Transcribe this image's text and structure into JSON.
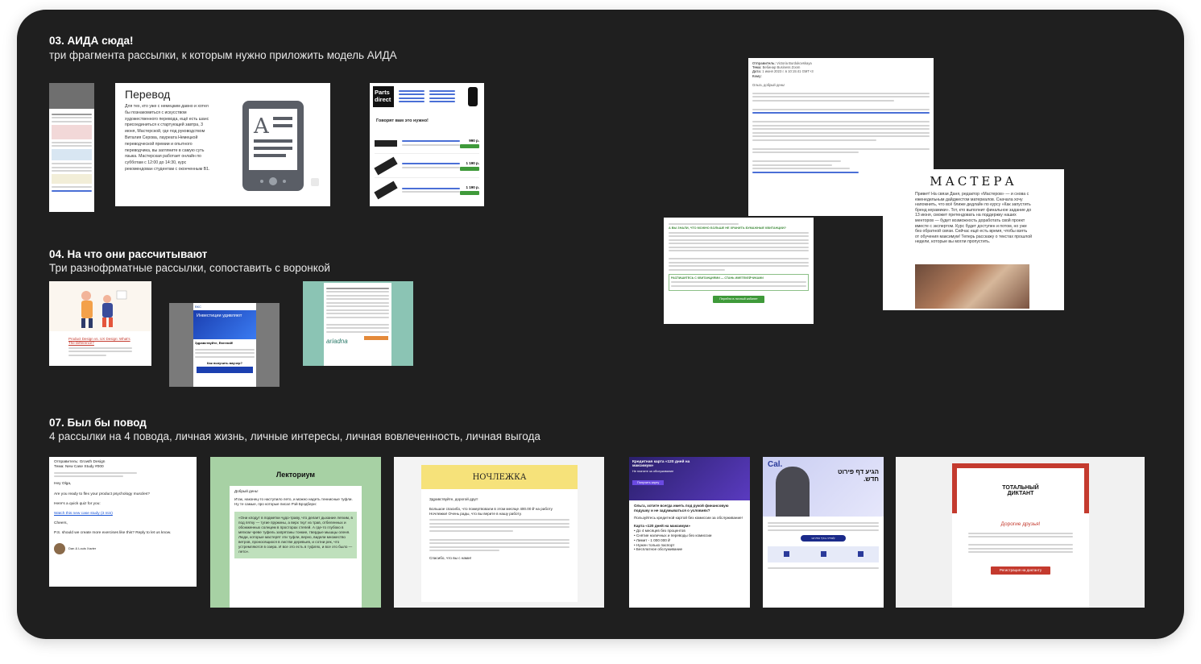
{
  "sections": {
    "s03": {
      "title": "03. АИДА сюда!",
      "subtitle": "три фрагмента рассылки, к которым нужно приложить модель АИДА"
    },
    "s04": {
      "title": "04. На что они рассчитывают",
      "subtitle": "Три разнофрматные рассылки, сопоставить с воронкой"
    },
    "s07": {
      "title": "07. Был бы повод",
      "subtitle": "4 рассылки на 4 повода, личная жизнь, личные интересы, личная вовлеченность, личная выгода"
    }
  },
  "cards": {
    "perevod": {
      "title": "Перевод",
      "body": "Для тех, кто уже с немецким давно и хотел бы познакомиться с искусством художественного перевода, ещё есть шанс присоединиться к стартующей завтра, 3 июня, Мастерской, где под руководством Виталия Серова, лауреата Немецкой переводческой премии и опытного переводчика, вы загляните в самую суть языка. Мастерская работает онлайн по субботам с 12:00 до 14:30, курс рекомендован студентам с оконченным B1."
    },
    "parts": {
      "logo_line1": "Parts",
      "logo_line2": "direct",
      "headline": "Говорят вам это нужно!",
      "prices": [
        "990 р.",
        "1 190 р.",
        "1 190 р."
      ]
    },
    "business_email": {
      "from_label": "Отправитель:",
      "from": "Victoria Burdukovskaya",
      "subject_label": "Тема:",
      "subject": "Вебинар Business Zoom",
      "date_label": "Дата:",
      "date": "1 июня 2023 г. в 10:15:41 GMT+3",
      "to_label": "Кому:",
      "greeting": "Ольга, добрый день!"
    },
    "mastera": {
      "logo": "МАСТЕРА",
      "body": "Привет! На связи Даня, редактор «Мастеров» — и снова с еженедельным дайджестом материалов. Сначала хочу напомнить, что всё ближе дедлайн по курсу «Как запустить бренд керамики». Тот, кто выполнит финальное задание до 13 июня, сможет претендовать на поддержку наших менторов — будет возможность доработать свой проект вместе с экспертом. Курс будет доступен и потом, но уже без обратной связи. Сейчас ещё есть время, чтобы взять от обучения максимум! Теперь расскажу о текстах прошлой недели, которые вы могли пропустить."
    },
    "green_notice": {
      "heading": "А ВЫ ЗНАЛИ, ЧТО МОЖНО БОЛЬШЕ НЕ ХРАНИТЬ БУМАЖНЫЕ КВИТАНЦИИ?",
      "section": "РАСПИШИТЕСЬ С КВИТАНЦИЯМИ — СТАНЬ ИМЕТЕКЕЙЧИКАМИ",
      "button": "Перейти в личный кабинет"
    },
    "product_design": {
      "title": "Product Design vs. UX Design: What's The Difference?"
    },
    "vtb": {
      "banner": "Инвестиции удивляют",
      "greeting": "Здравствуйте, Евгений!",
      "question": "Как получить ваучер?"
    },
    "ariadna": {
      "logo": "ariadna"
    },
    "growth": {
      "from": "Отправитель: Growth Design",
      "subject": "Тема: New Case Study #000",
      "hey": "Hey Olga,",
      "q": "Are you ready to flex your product psychology muscles?",
      "quiz": "Here's a quick quiz for you:",
      "link": "Watch this new case study (3 min)",
      "cheers": "Cheers,",
      "ps": "P.S. should we create more exercises like this? Reply to let us know.",
      "sign": "Dan & Louis Xavier"
    },
    "lektorium": {
      "logo": "Лекториум",
      "hello": "Добрый день!",
      "body": "Итак, наконец-то наступило лето, и можно надеть теннисные туфли. Ну те самые, про которые писал Рэй Брэдбери:",
      "quote": "«Они клодут в подметки чудо-траву, что делает дыхание легким, в под пятку — тугие пружины, а верх ткут из трав, отбеленных и обожженных солнцем в просторах степей. А где-то глубоко в мягком чреве туфель запрятаны тонкие, твердые мышцы оленя. Люди, которые мастерят эти туфли, верно, видели множество ветров, проносящихся в листве деревьев, и сотни рек, что устремляются в озера. И все это есть в туфлях, и все это было — лето»."
    },
    "nochlezhka": {
      "logo": "НОЧЛЕЖКА",
      "greeting": "Здравствуйте, дорогой друг!",
      "body": "Большое спасибо, что пожертвовали в этом месяце 400.00 ₽ на работу Ночлежки! Очень рады, что вы верите в нашу работу.",
      "sign": "Спасибо, что вы с нами!"
    },
    "credit": {
      "banner": "Кредитная карта «120 дней на максимум»",
      "sub": "Не платите за обслуживание",
      "btn": "Получить карту",
      "h": "Ольга, хотите всегда иметь под рукой финансовую подушку и не задумываться о условиях?",
      "p": "Пользуйтесь кредитной картой без комиссии за обслуживание!",
      "h2": "Карта «120 дней на максимум»",
      "items": [
        "До 4 месяцев без процентов",
        "Снятие наличных и переводы без комиссии",
        "Лимит - 1 000 000 ₽",
        "Нужен только паспорт",
        "Бесплатное обслуживание"
      ]
    },
    "cal": {
      "logo": "Cal.",
      "headline": "הגיע דף פירוט חדש.",
      "btn": "לצפייה בדף הפירוט"
    },
    "totalny": {
      "logo": "ТОТАЛЬНЫЙ ДИКТАНТ",
      "greeting": "Дорогие друзья!",
      "btn": "Регистрация на диктанту"
    }
  },
  "colors": {
    "board": "#1f1f1f",
    "green": "#3f9a3a",
    "purple": "#3a2a8c",
    "red": "#c43a2e",
    "nochlezhka_yellow": "#f6e27a",
    "lektorium_green": "#a7d1a4"
  }
}
